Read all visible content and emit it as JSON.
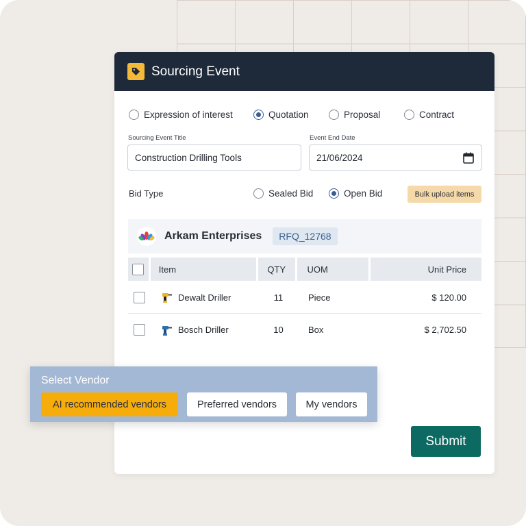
{
  "header": {
    "title": "Sourcing Event"
  },
  "event_types": [
    {
      "label": "Expression of interest",
      "selected": false
    },
    {
      "label": "Quotation",
      "selected": true
    },
    {
      "label": "Proposal",
      "selected": false
    },
    {
      "label": "Contract",
      "selected": false
    }
  ],
  "fields": {
    "title_label": "Sourcing Event Title",
    "title_value": "Construction Drilling Tools",
    "end_date_label": "Event End Date",
    "end_date_value": "21/06/2024"
  },
  "bid": {
    "label": "Bid Type",
    "options": [
      {
        "label": "Sealed Bid",
        "selected": false
      },
      {
        "label": "Open Bid",
        "selected": true
      }
    ],
    "bulk_upload_label": "Bulk upload items"
  },
  "vendor": {
    "name": "Arkam Enterprises",
    "rfq": "RFQ_12768"
  },
  "table": {
    "headers": [
      "Item",
      "QTY",
      "UOM",
      "Unit Price"
    ],
    "rows": [
      {
        "item": "Dewalt Driller",
        "qty": "11",
        "uom": "Piece",
        "price": "$ 120.00"
      },
      {
        "item": "Bosch Driller",
        "qty": "10",
        "uom": "Box",
        "price": "$ 2,702.50"
      }
    ]
  },
  "submit_label": "Submit",
  "select_vendor": {
    "title": "Select Vendor",
    "options": [
      "AI recommended vendors",
      "Preferred vendors",
      "My vendors"
    ],
    "active": "AI recommended vendors"
  },
  "colors": {
    "header_bg": "#1e2a3a",
    "accent_blue": "#3a5e92",
    "submit_green": "#0c6a63",
    "ai_orange": "#f6ad0c",
    "panel_blue": "#a3b8d4"
  },
  "icons": {
    "header": "tag-icon",
    "date": "calendar-icon",
    "vendor_logo": "lotus-logo-icon",
    "row_1": "drill-yellow-icon",
    "row_2": "drill-blue-icon"
  }
}
